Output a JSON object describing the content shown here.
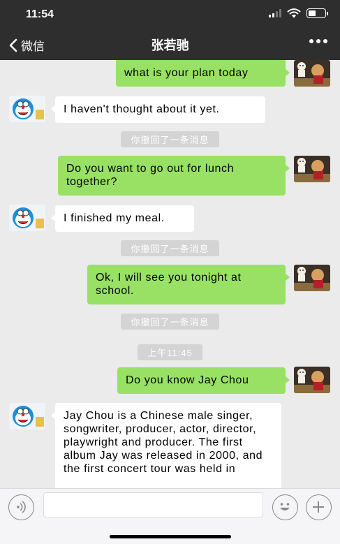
{
  "status_bar": {
    "time": "11:54"
  },
  "nav": {
    "back_label": "微信",
    "title": "张若驰"
  },
  "messages": [
    {
      "side": "me",
      "text": "what is your plan today"
    },
    {
      "side": "them",
      "text": "I haven't thought about it yet."
    },
    {
      "system": "你撤回了一条消息"
    },
    {
      "side": "me",
      "text": "Do you want to go out for lunch together?"
    },
    {
      "side": "them",
      "text": "I finished my meal."
    },
    {
      "system": "你撤回了一条消息"
    },
    {
      "side": "me",
      "text": "Ok, I will see you tonight at school."
    },
    {
      "system": "你撤回了一条消息"
    },
    {
      "timestamp": "上午11:45"
    },
    {
      "side": "me",
      "text": "Do you know Jay Chou"
    },
    {
      "side": "them",
      "text": "Jay Chou is a Chinese male singer, songwriter, producer, actor, director, playwright and producer. The first album Jay was released in 2000, and the first concert tour was held in"
    }
  ],
  "input_bar": {
    "text_value": ""
  },
  "colors": {
    "header_bg": "#2e2e2e",
    "chat_bg": "#ebebeb",
    "my_bubble": "#98e165",
    "their_bubble": "#ffffff"
  },
  "icons": [
    "back-chevron-icon",
    "more-dots-icon",
    "voice-icon",
    "emoji-icon",
    "plus-icon",
    "signal-icon",
    "wifi-icon",
    "battery-icon"
  ]
}
